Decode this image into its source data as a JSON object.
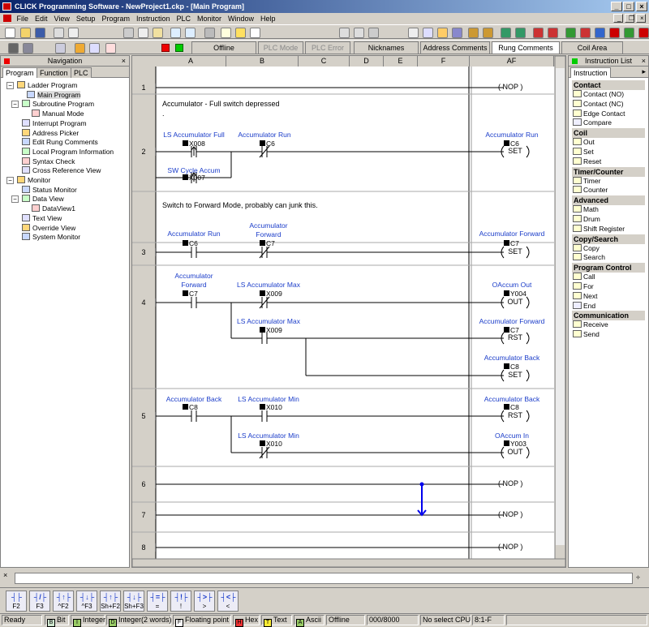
{
  "window": {
    "title": "CLICK Programming Software - NewProject1.ckp - [Main Program]"
  },
  "menu": [
    "File",
    "Edit",
    "View",
    "Setup",
    "Program",
    "Instruction",
    "PLC",
    "Monitor",
    "Window",
    "Help"
  ],
  "toolbar2": {
    "offline": "Offline",
    "plc_mode": "PLC Mode",
    "plc_error": "PLC Error",
    "nicknames": "Nicknames",
    "address_comments": "Address Comments",
    "rung_comments": "Rung Comments",
    "coil_area": "Coil Area"
  },
  "navigation": {
    "title": "Navigation",
    "tabs": [
      "Program",
      "Function",
      "PLC"
    ],
    "tree": [
      {
        "label": "Ladder Program",
        "level": 0,
        "pm": "-"
      },
      {
        "label": "Main Program",
        "level": 2,
        "selected": true
      },
      {
        "label": "Subroutine Program",
        "level": 1,
        "pm": "-"
      },
      {
        "label": "Manual Mode",
        "level": 3
      },
      {
        "label": "Interrupt Program",
        "level": 1
      },
      {
        "label": "Address Picker",
        "level": 1
      },
      {
        "label": "Edit Rung Comments",
        "level": 1
      },
      {
        "label": "Local Program Information",
        "level": 1
      },
      {
        "label": "Syntax Check",
        "level": 1
      },
      {
        "label": "Cross Reference View",
        "level": 1
      },
      {
        "label": "Monitor",
        "level": 0,
        "pm": "-"
      },
      {
        "label": "Status Monitor",
        "level": 1
      },
      {
        "label": "Data View",
        "level": 1,
        "pm": "-"
      },
      {
        "label": "DataView1",
        "level": 3
      },
      {
        "label": "Text View",
        "level": 1
      },
      {
        "label": "Override View",
        "level": 1
      },
      {
        "label": "System Monitor",
        "level": 1
      }
    ]
  },
  "ladder": {
    "columns": [
      "A",
      "B",
      "C",
      "D",
      "E",
      "F",
      "AF"
    ],
    "rung_numbers": [
      "1",
      "2",
      "3",
      "4",
      "5",
      "6",
      "7",
      "8"
    ],
    "nop": "( NOP )",
    "comments": {
      "r2": "Accumulator - Full switch depressed",
      "r2b": ".",
      "r3": "Switch to Forward Mode, probably can junk this."
    },
    "elements": {
      "r2_c1_name": "LS Accumulator Full",
      "r2_c1_addr": "X008",
      "r2_c2_name": "Accumulator Run",
      "r2_c2_addr": "C6",
      "r2_c3_name": "SW Cycle Accum",
      "r2_c3_addr": "X007",
      "r2_coil_name": "Accumulator Run",
      "r2_coil_addr": "C6",
      "r2_coil_op": "SET",
      "r3_c1_name": "Accumulator Run",
      "r3_c1_addr": "C6",
      "r3_c2_name1": "Accumulator",
      "r3_c2_name2": "Forward",
      "r3_c2_addr": "C7",
      "r3_coil_name": "Accumulator Forward",
      "r3_coil_addr": "C7",
      "r3_coil_op": "SET",
      "r4_c1_name1": "Accumulator",
      "r4_c1_name2": "Forward",
      "r4_c1_addr": "C7",
      "r4_c2_name": "LS Accumulator Max",
      "r4_c2_addr": "X009",
      "r4_c3_name": "LS Accumulator Max",
      "r4_c3_addr": "X009",
      "r4_coil1_name": "OAccum Out",
      "r4_coil1_addr": "Y004",
      "r4_coil1_op": "OUT",
      "r4_coil2_name": "Accumulator Forward",
      "r4_coil2_addr": "C7",
      "r4_coil2_op": "RST",
      "r4_coil3_name": "Accumulator Back",
      "r4_coil3_addr": "C8",
      "r4_coil3_op": "SET",
      "r5_c1_name": "Accumulator Back",
      "r5_c1_addr": "C8",
      "r5_c2_name": "LS Accumulator Min",
      "r5_c2_addr": "X010",
      "r5_c3_name": "LS Accumulator Min",
      "r5_c3_addr": "X010",
      "r5_coil1_name": "Accumulator Back",
      "r5_coil1_addr": "C8",
      "r5_coil1_op": "RST",
      "r5_coil2_name": "OAccum In",
      "r5_coil2_addr": "Y003",
      "r5_coil2_op": "OUT"
    }
  },
  "instruction_list": {
    "title": "Instruction List",
    "tab": "Instruction",
    "groups": [
      {
        "name": "Contact",
        "items": [
          "Contact (NO)",
          "Contact (NC)",
          "Edge Contact",
          "Compare"
        ]
      },
      {
        "name": "Coil",
        "items": [
          "Out",
          "Set",
          "Reset"
        ]
      },
      {
        "name": "Timer/Counter",
        "items": [
          "Timer",
          "Counter"
        ]
      },
      {
        "name": "Advanced",
        "items": [
          "Math",
          "Drum",
          "Shift Register"
        ]
      },
      {
        "name": "Copy/Search",
        "items": [
          "Copy",
          "Search"
        ]
      },
      {
        "name": "Program Control",
        "items": [
          "Call",
          "For",
          "Next",
          "End"
        ]
      },
      {
        "name": "Communication",
        "items": [
          "Receive",
          "Send"
        ]
      }
    ]
  },
  "function_keys": [
    "F2",
    "F3",
    "^F2",
    "^F3",
    "Sh+F2",
    "Sh+F3",
    "=",
    "!",
    ">",
    "<"
  ],
  "status": {
    "ready": "Ready",
    "bit": "Bit",
    "integer": "Integer",
    "integer2": "Integer(2 words)",
    "float": "Floating point",
    "hex": "Hex",
    "text": "Text",
    "ascii": "Ascii",
    "mode": "Offline",
    "mem": "000/8000",
    "cpu": "No select CPU",
    "pos": "8:1-F"
  },
  "colors": {
    "title": "#0a246a",
    "label": "#1a3cc9",
    "wire": "#000000",
    "cursor": "#0000ee"
  }
}
